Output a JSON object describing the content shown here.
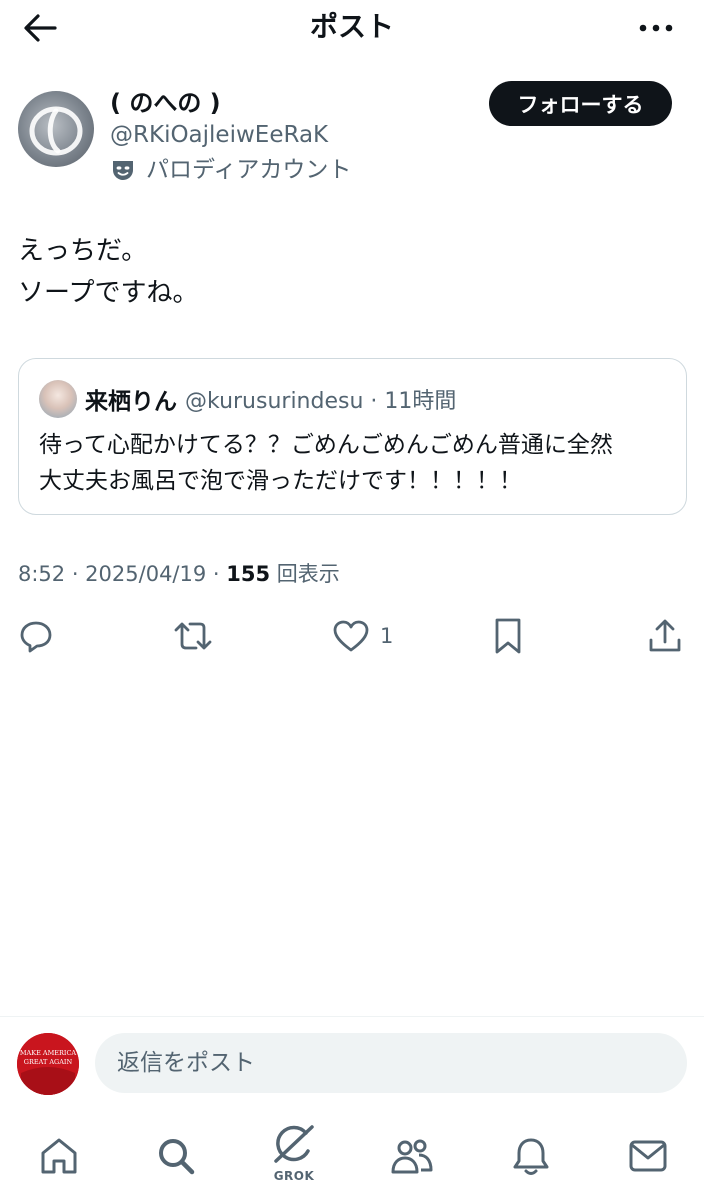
{
  "header": {
    "title": "ポスト",
    "back_icon": "arrow-left-icon",
    "more_icon": "more-horizontal-icon"
  },
  "author": {
    "display_name": "( のへの )",
    "handle": "@RKiOajleiwEeRaK",
    "parody_label": "パロディアカウント",
    "follow_label": "フォローする"
  },
  "post": {
    "lines": [
      "えっちだ。",
      "ソープですね。"
    ]
  },
  "quote": {
    "name": "来栖りん",
    "meta": "@kurusurindesu · 11時間",
    "lines": [
      "待って心配かけてる？？ごめんごめんごめん普通に全然",
      "大丈夫お風呂で泡で滑っただけです！！！！！"
    ]
  },
  "meta": {
    "time_date": "8:52 · 2025/04/19 · ",
    "views_count": "155",
    "views_label": " 回表示"
  },
  "actions": {
    "like_count": "1"
  },
  "reply": {
    "placeholder": "返信をポスト",
    "avatar_text_1": "MAKE AMERICA",
    "avatar_text_2": "GREAT AGAIN"
  },
  "tabbar": {
    "grok_label": "GROK"
  },
  "colors": {
    "text": "#0f1419",
    "secondary": "#536471",
    "border": "#cfd9de",
    "reply_bg": "#eff3f4",
    "cap_red": "#d01f27"
  }
}
